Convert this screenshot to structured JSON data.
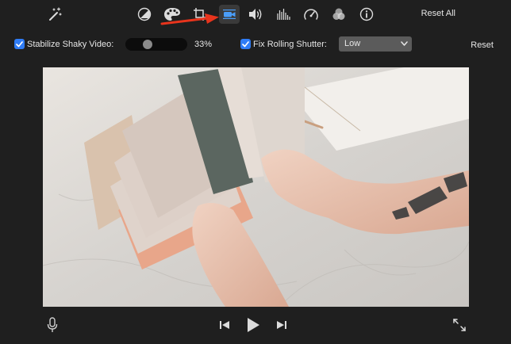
{
  "toolbar": {
    "icons": [
      "magic-wand-icon",
      "color-balance-icon",
      "color-palette-icon",
      "crop-icon",
      "video-camera-icon",
      "speaker-icon",
      "equalizer-icon",
      "speedometer-icon",
      "filter-circles-icon",
      "info-icon"
    ],
    "active_icon": "video-camera-icon",
    "reset_all_label": "Reset All"
  },
  "controls": {
    "stabilize": {
      "checked": true,
      "label": "Stabilize Shaky Video:",
      "slider_value": 0.33,
      "percent_label": "33%"
    },
    "rolling_shutter": {
      "checked": true,
      "label": "Fix Rolling Shutter:",
      "selected_option": "Low"
    },
    "reset_label": "Reset"
  },
  "playback": {
    "icons": [
      "microphone-icon",
      "skip-back-icon",
      "play-icon",
      "skip-forward-icon",
      "fullscreen-icon"
    ]
  },
  "colors": {
    "background": "#1f1f1f",
    "checkbox_accent": "#2f7cf6",
    "active_icon": "#4a9df8",
    "annotation_arrow": "#e8341c"
  }
}
